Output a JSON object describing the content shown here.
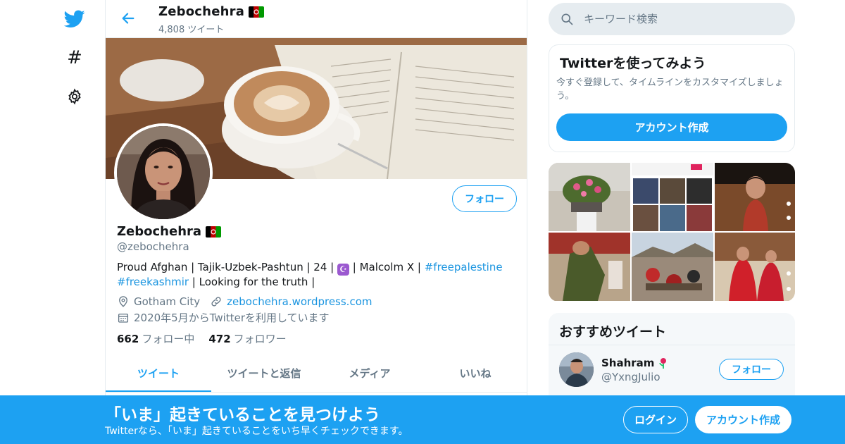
{
  "colors": {
    "brand": "#1da1f2",
    "link": "#1b95e0",
    "muted": "#657786",
    "border": "#e6ecf0"
  },
  "rail": {
    "icons": [
      "twitter-bird-icon",
      "hashtag-icon",
      "gear-icon"
    ],
    "hashtag_glyph": "#"
  },
  "header": {
    "name": "Zebochehra",
    "tweet_count": "4,808 ツイート",
    "back_icon": "arrow-left-icon"
  },
  "profile": {
    "display_name": "Zebochehra",
    "flag_emoji": "afghanistan-flag",
    "handle": "@zebochehra",
    "follow_label": "フォロー",
    "bio": {
      "part1": "Proud Afghan | Tajik-Uzbek-Pashtun | 24 | ",
      "emoji": "☪",
      "part2": " | Malcolm X | ",
      "tag1": "#freepalestine",
      "tag2": "#freekashmir",
      "part3": " | Looking for the truth |"
    },
    "location": "Gotham City",
    "website": "zebochehra.wordpress.com",
    "joined": "2020年5月からTwitterを利用しています",
    "following_count": "662",
    "following_label": "フォロー中",
    "followers_count": "472",
    "followers_label": "フォロワー"
  },
  "tabs": [
    {
      "label": "ツイート",
      "active": true
    },
    {
      "label": "ツイートと返信",
      "active": false
    },
    {
      "label": "メディア",
      "active": false
    },
    {
      "label": "いいね",
      "active": false
    }
  ],
  "search": {
    "placeholder": "キーワード検索"
  },
  "signup_card": {
    "title": "Twitterを使ってみよう",
    "subtitle": "今すぐ登録して、タイムラインをカスタマイズしましょう。",
    "button": "アカウント作成"
  },
  "media_grid": {
    "count": 6
  },
  "recommended": {
    "title": "おすすめツイート",
    "user_name": "Shahram",
    "user_emoji": "rose-icon",
    "user_handle": "@YxngJulio",
    "follow_label": "フォロー"
  },
  "bottom_bar": {
    "title": "「いま」起きていることを見つけよう",
    "subtitle": "Twitterなら、「いま」起きていることをいち早くチェックできます。",
    "login_label": "ログイン",
    "signup_label": "アカウント作成"
  }
}
